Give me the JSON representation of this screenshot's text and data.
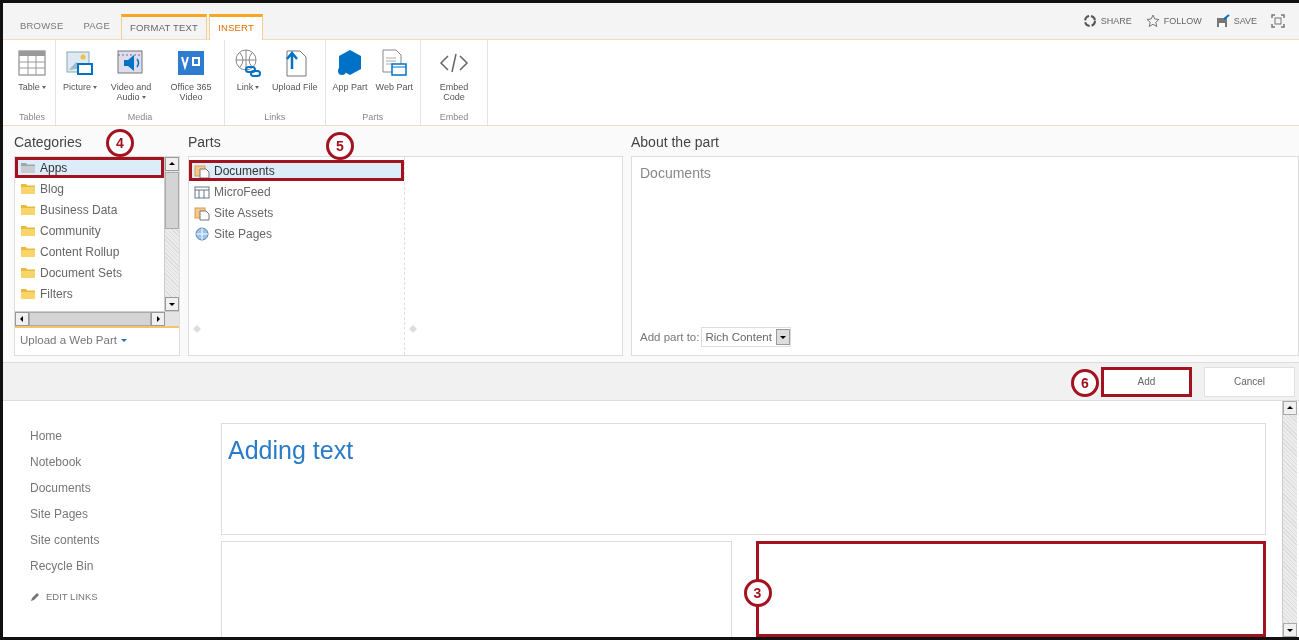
{
  "ribbon": {
    "tabs": [
      {
        "label": "BROWSE",
        "selected": false,
        "contextual": false
      },
      {
        "label": "PAGE",
        "selected": false,
        "contextual": false
      },
      {
        "label": "FORMAT TEXT",
        "selected": false,
        "contextual": true
      },
      {
        "label": "INSERT",
        "selected": true,
        "contextual": true
      }
    ],
    "actions": [
      {
        "kind": "share",
        "label": "SHARE"
      },
      {
        "kind": "follow",
        "label": "FOLLOW"
      },
      {
        "kind": "save",
        "label": "SAVE"
      },
      {
        "kind": "focus"
      }
    ],
    "groups": [
      {
        "label": "Tables",
        "buttons": [
          {
            "kind": "table",
            "label": "Table",
            "dropdown": true
          }
        ]
      },
      {
        "label": "Media",
        "buttons": [
          {
            "kind": "picture",
            "label": "Picture",
            "dropdown": true
          },
          {
            "kind": "video",
            "label": "Video and Audio",
            "dropdown": true
          },
          {
            "kind": "office-video",
            "label": "Office 365 Video",
            "dropdown": false
          }
        ]
      },
      {
        "label": "Links",
        "buttons": [
          {
            "kind": "link",
            "label": "Link",
            "dropdown": true
          },
          {
            "kind": "upload",
            "label": "Upload File",
            "dropdown": false
          }
        ]
      },
      {
        "label": "Parts",
        "buttons": [
          {
            "kind": "app-part",
            "label": "App Part",
            "dropdown": false
          },
          {
            "kind": "web-part",
            "label": "Web Part",
            "dropdown": false
          }
        ]
      },
      {
        "label": "Embed",
        "buttons": [
          {
            "kind": "embed",
            "label": "Embed Code",
            "dropdown": false
          }
        ]
      }
    ]
  },
  "picker": {
    "categories": {
      "title": "Categories",
      "footer": "Upload a Web Part",
      "items": [
        {
          "kind": "apps",
          "label": "Apps",
          "selected": true,
          "highlighted": true,
          "callout": "4"
        },
        {
          "kind": "folder",
          "label": "Blog",
          "selected": false,
          "highlighted": false
        },
        {
          "kind": "folder",
          "label": "Business Data",
          "selected": false,
          "highlighted": false
        },
        {
          "kind": "folder",
          "label": "Community",
          "selected": false,
          "highlighted": false
        },
        {
          "kind": "folder",
          "label": "Content Rollup",
          "selected": false,
          "highlighted": false
        },
        {
          "kind": "folder",
          "label": "Document Sets",
          "selected": false,
          "highlighted": false
        },
        {
          "kind": "folder",
          "label": "Filters",
          "selected": false,
          "highlighted": false
        }
      ]
    },
    "parts": {
      "title": "Parts",
      "items": [
        {
          "kind": "library",
          "label": "Documents",
          "selected": true,
          "highlighted": true,
          "callout": "5"
        },
        {
          "kind": "feed",
          "label": "MicroFeed",
          "selected": false,
          "highlighted": false
        },
        {
          "kind": "library",
          "label": "Site Assets",
          "selected": false,
          "highlighted": false
        },
        {
          "kind": "pages",
          "label": "Site Pages",
          "selected": false,
          "highlighted": false
        }
      ]
    },
    "about": {
      "title": "About the part",
      "name": "Documents",
      "add_to_label": "Add part to:",
      "add_to_value": "Rich Content"
    },
    "buttons": [
      {
        "label": "Add",
        "highlighted": true,
        "callout": "6"
      },
      {
        "label": "Cancel",
        "highlighted": false
      }
    ]
  },
  "nav": {
    "items": [
      "Home",
      "Notebook",
      "Documents",
      "Site Pages",
      "Site contents",
      "Recycle Bin"
    ],
    "edit_links": "EDIT LINKS"
  },
  "content": {
    "title": "Adding text",
    "zones": [
      {
        "highlighted": false
      },
      {
        "highlighted": true,
        "callout": "3"
      }
    ]
  }
}
